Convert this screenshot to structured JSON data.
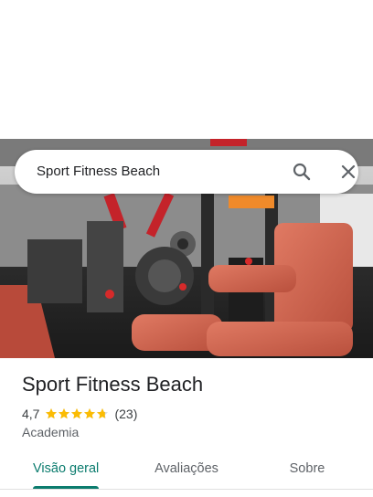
{
  "search": {
    "query": "Sport Fitness Beach",
    "search_icon": "search-icon",
    "close_icon": "close-icon"
  },
  "place": {
    "name": "Sport Fitness Beach",
    "rating": "4,7",
    "rating_value": 4.7,
    "stars_max": 5,
    "review_count": "(23)",
    "category": "Academia",
    "photo": "gym-interior-photo"
  },
  "tabs": [
    {
      "label": "Visão geral",
      "active": true
    },
    {
      "label": "Avaliações",
      "active": false
    },
    {
      "label": "Sobre",
      "active": false
    }
  ],
  "colors": {
    "accent": "#0b7c6e",
    "star": "#fbbc04",
    "text": "#202124",
    "secondary_text": "#5f6368"
  }
}
